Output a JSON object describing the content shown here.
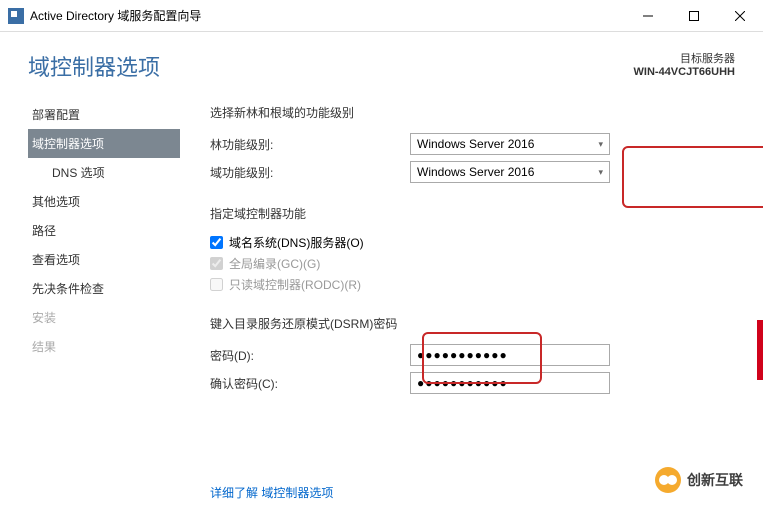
{
  "titlebar": {
    "text": "Active Directory 域服务配置向导"
  },
  "header": {
    "title": "域控制器选项",
    "serverLabel": "目标服务器",
    "serverName": "WIN-44VCJT66UHH"
  },
  "sidebar": {
    "items": [
      {
        "label": "部署配置",
        "active": false,
        "sub": false,
        "disabled": false
      },
      {
        "label": "域控制器选项",
        "active": true,
        "sub": false,
        "disabled": false
      },
      {
        "label": "DNS 选项",
        "active": false,
        "sub": true,
        "disabled": false
      },
      {
        "label": "其他选项",
        "active": false,
        "sub": false,
        "disabled": false
      },
      {
        "label": "路径",
        "active": false,
        "sub": false,
        "disabled": false
      },
      {
        "label": "查看选项",
        "active": false,
        "sub": false,
        "disabled": false
      },
      {
        "label": "先决条件检查",
        "active": false,
        "sub": false,
        "disabled": false
      },
      {
        "label": "安装",
        "active": false,
        "sub": false,
        "disabled": true
      },
      {
        "label": "结果",
        "active": false,
        "sub": false,
        "disabled": true
      }
    ]
  },
  "main": {
    "section1Label": "选择新林和根域的功能级别",
    "forestLabel": "林功能级别:",
    "forestValue": "Windows Server 2016",
    "domainLabel": "域功能级别:",
    "domainValue": "Windows Server 2016",
    "section2Label": "指定域控制器功能",
    "dnsLabel": "域名系统(DNS)服务器(O)",
    "gcLabel": "全局编录(GC)(G)",
    "rodcLabel": "只读域控制器(RODC)(R)",
    "section3Label": "键入目录服务还原模式(DSRM)密码",
    "pwdLabel": "密码(D):",
    "pwdValue": "●●●●●●●●●●●",
    "pwd2Label": "确认密码(C):",
    "pwd2Value": "●●●●●●●●●●●",
    "moreLink": "详细了解 域控制器选项"
  },
  "watermark": "创新互联"
}
